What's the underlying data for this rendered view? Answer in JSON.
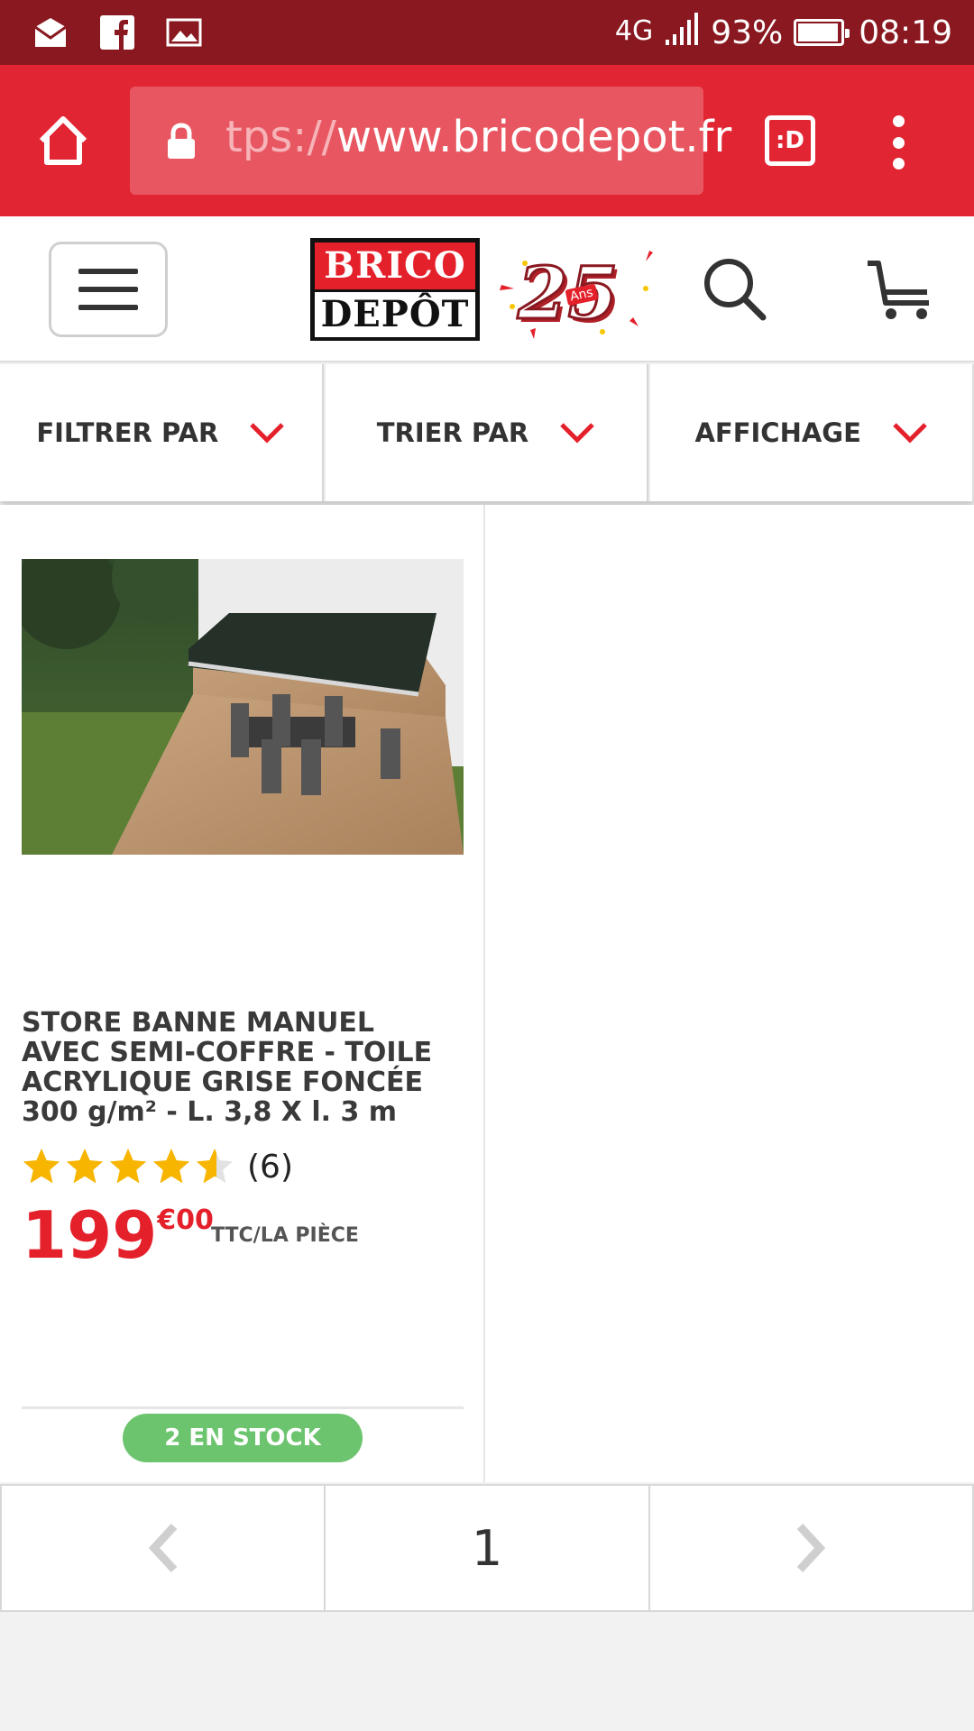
{
  "status_bar": {
    "network": "4G",
    "battery": "93%",
    "time": "08:19",
    "notification_icons": [
      "mail-icon",
      "facebook-icon",
      "image-icon"
    ]
  },
  "browser": {
    "url_scheme": "tps://",
    "url_host": "www.bricodepot.fr",
    "tab_label": ":D"
  },
  "site_header": {
    "logo_line1": "BRICO",
    "logo_line2": "DEPÔT",
    "anniversary_number": "25",
    "anniversary_text": "Ans"
  },
  "filters": [
    {
      "label": "FILTRER PAR"
    },
    {
      "label": "TRIER PAR"
    },
    {
      "label": "AFFICHAGE"
    }
  ],
  "product": {
    "title": "STORE BANNE MANUEL AVEC SEMI-COFFRE - TOILE ACRYLIQUE GRISE FONCÉE 300 g/m² - L. 3,8 X l. 3 m",
    "rating": 4.5,
    "rating_max": 5,
    "review_count": "(6)",
    "price_int": "199",
    "price_dec": "€00",
    "price_unit": "TTC/LA PIÈCE",
    "stock": "2 EN STOCK"
  },
  "pagination": {
    "current_page": "1"
  },
  "colors": {
    "brand_red": "#e12533",
    "status_bar": "#8a1820",
    "price_red": "#e4202b",
    "stock_green": "#6cc46e",
    "star_yellow": "#f7b500"
  }
}
